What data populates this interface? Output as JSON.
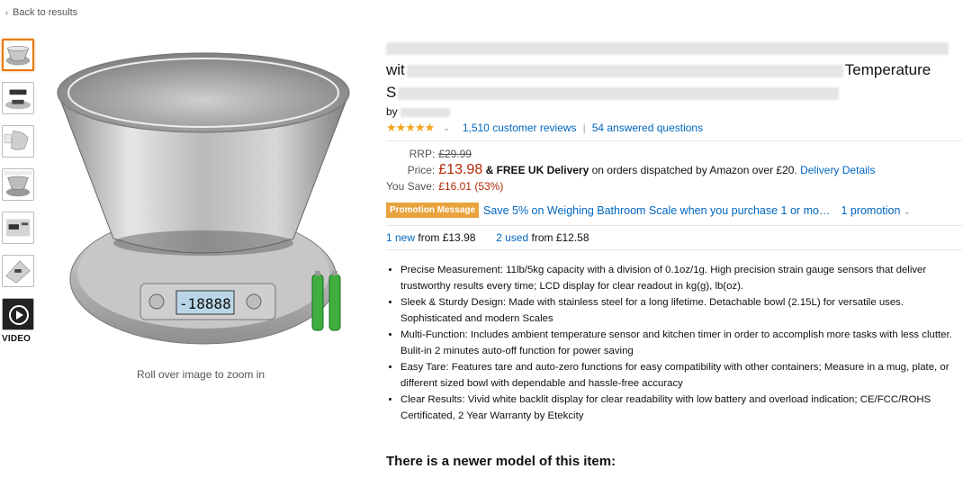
{
  "nav": {
    "back_label": "Back to results"
  },
  "gallery": {
    "video_label": "VIDEO",
    "zoom_hint": "Roll over image to zoom in"
  },
  "product": {
    "title_line2_visible": "wit",
    "title_line2_end": "Temperature",
    "title_line3_start": "S",
    "by_label": "by",
    "rating_stars": "★★★★★",
    "reviews_link": "1,510 customer reviews",
    "answers_link": "54 answered questions"
  },
  "pricing": {
    "rrp_label": "RRP:",
    "rrp_value": "£29.99",
    "price_label": "Price:",
    "price_value": "£13.98",
    "delivery_bold": "& FREE UK Delivery",
    "delivery_text": "on orders dispatched by Amazon over £20.",
    "delivery_link": "Delivery Details",
    "save_label": "You Save:",
    "save_value": "£16.01 (53%)"
  },
  "promotion": {
    "badge": "Promotion Message",
    "text": "Save 5% on Weighing Bathroom Scale when you purchase 1 or mo…",
    "more": "1 promotion"
  },
  "offers": {
    "new_count": "1 new",
    "new_from": "from £13.98",
    "used_count": "2 used",
    "used_from": "from £12.58"
  },
  "bullets": [
    "Precise Measurement: 11lb/5kg capacity with a division of 0.1oz/1g. High precision strain gauge sensors that deliver trustworthy results every time; LCD display for clear readout in kg(g), lb(oz).",
    "Sleek & Sturdy Design: Made with stainless steel for a long lifetime. Detachable bowl (2.15L) for versatile uses. Sophisticated and modern Scales",
    "Multi-Function: Includes ambient temperature sensor and kitchen timer in order to accomplish more tasks with less clutter. Bulit-in 2 minutes auto-off function for power saving",
    "Easy Tare: Features tare and auto-zero functions for easy compatibility with other containers; Measure in a mug, plate, or different sized bowl with dependable and hassle-free accuracy",
    "Clear Results: Vivid white backlit display for clear readability with low battery and overload indication; CE/FCC/ROHS Certificated, 2 Year Warranty by Etekcity"
  ],
  "newer_model": {
    "heading": "There is a newer model of this item:"
  },
  "colors": {
    "link": "#0066c0",
    "price": "#b12704",
    "star": "#f4a41c",
    "promo_badge": "#e8a33d",
    "thumb_active": "#e77600"
  }
}
